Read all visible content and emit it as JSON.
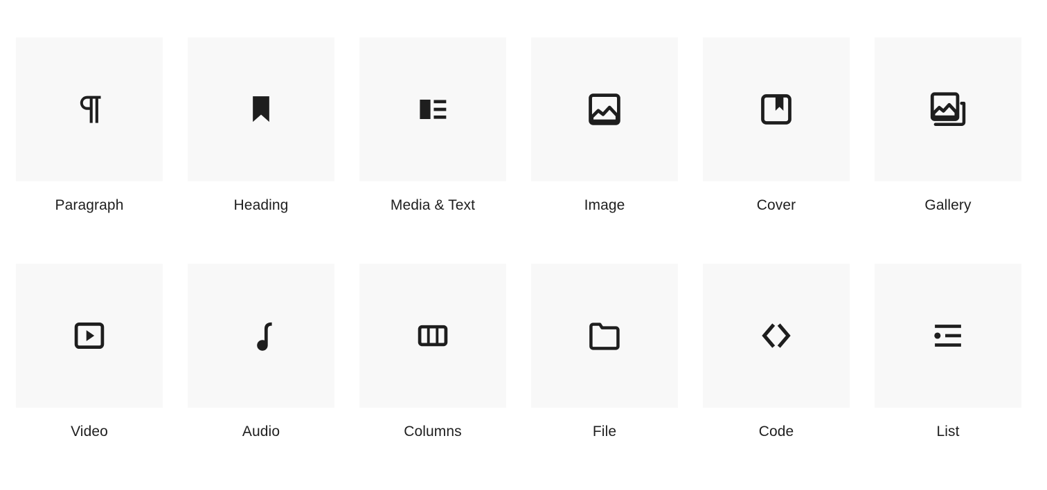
{
  "grid": {
    "columns": 6,
    "rows": 2,
    "tile_background": "#f8f8f8",
    "icon_color": "#1e1e1e",
    "label_color": "#1e1e1e",
    "page_background": "#ffffff"
  },
  "blocks": [
    {
      "label": "Paragraph",
      "icon": "paragraph-pilcrow-icon"
    },
    {
      "label": "Heading",
      "icon": "heading-bookmark-icon"
    },
    {
      "label": "Media & Text",
      "icon": "media-and-text-icon"
    },
    {
      "label": "Image",
      "icon": "image-icon"
    },
    {
      "label": "Cover",
      "icon": "cover-icon"
    },
    {
      "label": "Gallery",
      "icon": "gallery-icon"
    },
    {
      "label": "Video",
      "icon": "video-play-icon"
    },
    {
      "label": "Audio",
      "icon": "audio-note-icon"
    },
    {
      "label": "Columns",
      "icon": "columns-icon"
    },
    {
      "label": "File",
      "icon": "file-folder-icon"
    },
    {
      "label": "Code",
      "icon": "code-angle-brackets-icon"
    },
    {
      "label": "List",
      "icon": "list-icon"
    }
  ]
}
